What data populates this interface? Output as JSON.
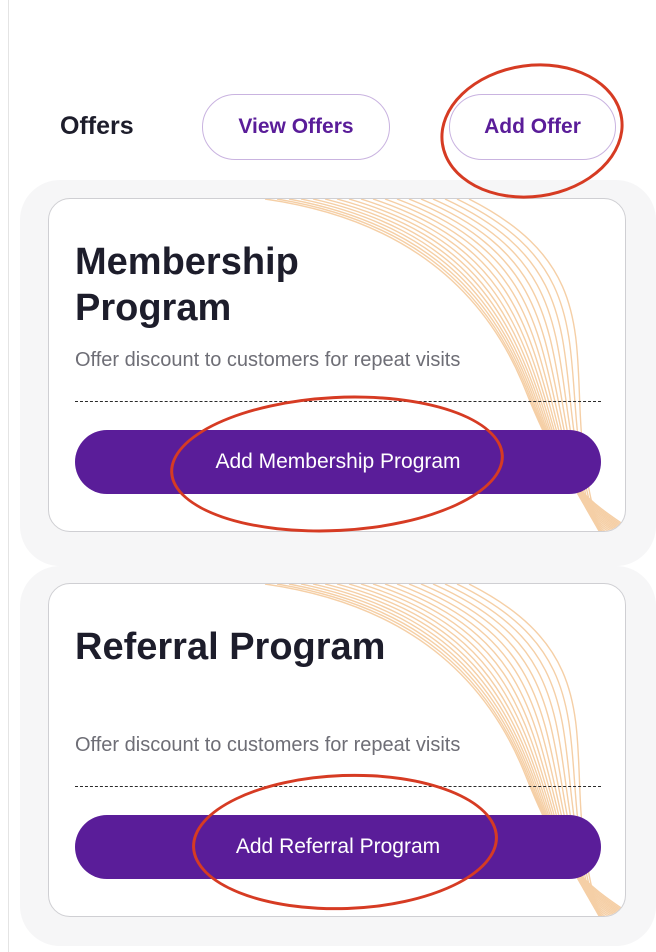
{
  "header": {
    "title": "Offers",
    "view_offers_label": "View Offers",
    "add_offer_label": "Add Offer"
  },
  "cards": [
    {
      "title": "Membership Program",
      "description": "Offer discount to customers for repeat visits",
      "cta_label": "Add Membership Program"
    },
    {
      "title": "Referral Program",
      "description": "Offer discount to customers for repeat visits",
      "cta_label": "Add Referral Program"
    }
  ],
  "colors": {
    "brand_purple": "#5a1d99",
    "annotation_red": "#d63b23",
    "wave_peach": "#f5cfa6"
  }
}
